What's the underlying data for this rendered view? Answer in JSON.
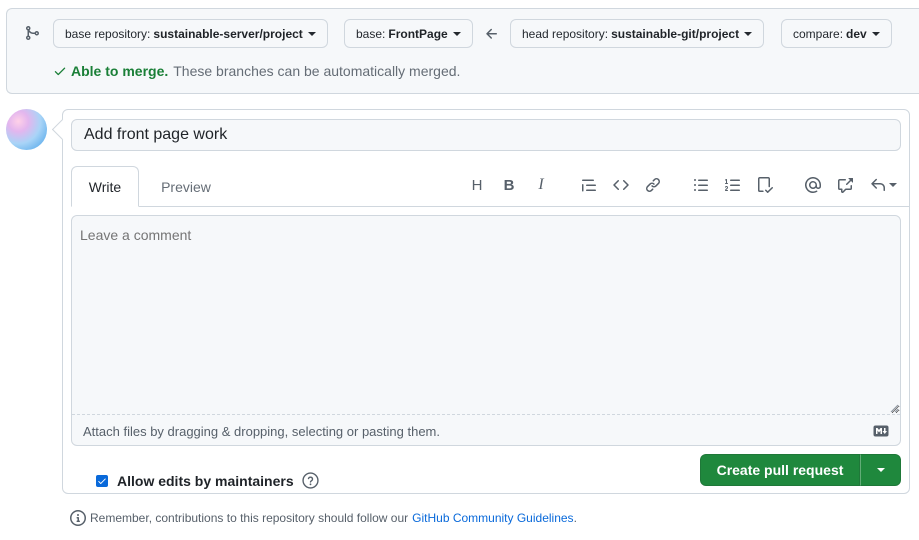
{
  "compare": {
    "base_repo_label": "base repository:",
    "base_repo_value": "sustainable-server/project",
    "base_label": "base:",
    "base_value": "FrontPage",
    "head_repo_label": "head repository:",
    "head_repo_value": "sustainable-git/project",
    "compare_label": "compare:",
    "compare_value": "dev",
    "merge_status_strong": "Able to merge.",
    "merge_status_text": "These branches can be automatically merged."
  },
  "composer": {
    "title_value": "Add front page work",
    "tabs": [
      {
        "label": "Write"
      },
      {
        "label": "Preview"
      }
    ],
    "toolbar": {
      "heading_glyph": "H",
      "bold_glyph": "B",
      "italic_glyph": "I"
    },
    "comment_placeholder": "Leave a comment",
    "attach_text": "Attach files by dragging & dropping, selecting or pasting them.",
    "allow_edits_label": "Allow edits by maintainers",
    "allow_edits_checked": true,
    "create_button_label": "Create pull request"
  },
  "footer": {
    "note_text": "Remember, contributions to this repository should follow our",
    "link_text": "GitHub Community Guidelines",
    "trailing": "."
  },
  "colors": {
    "accent_blue": "#0969da",
    "success_green": "#1a7f37",
    "button_green": "#1f883d",
    "border": "#d0d7de",
    "muted_text": "#656d76"
  }
}
